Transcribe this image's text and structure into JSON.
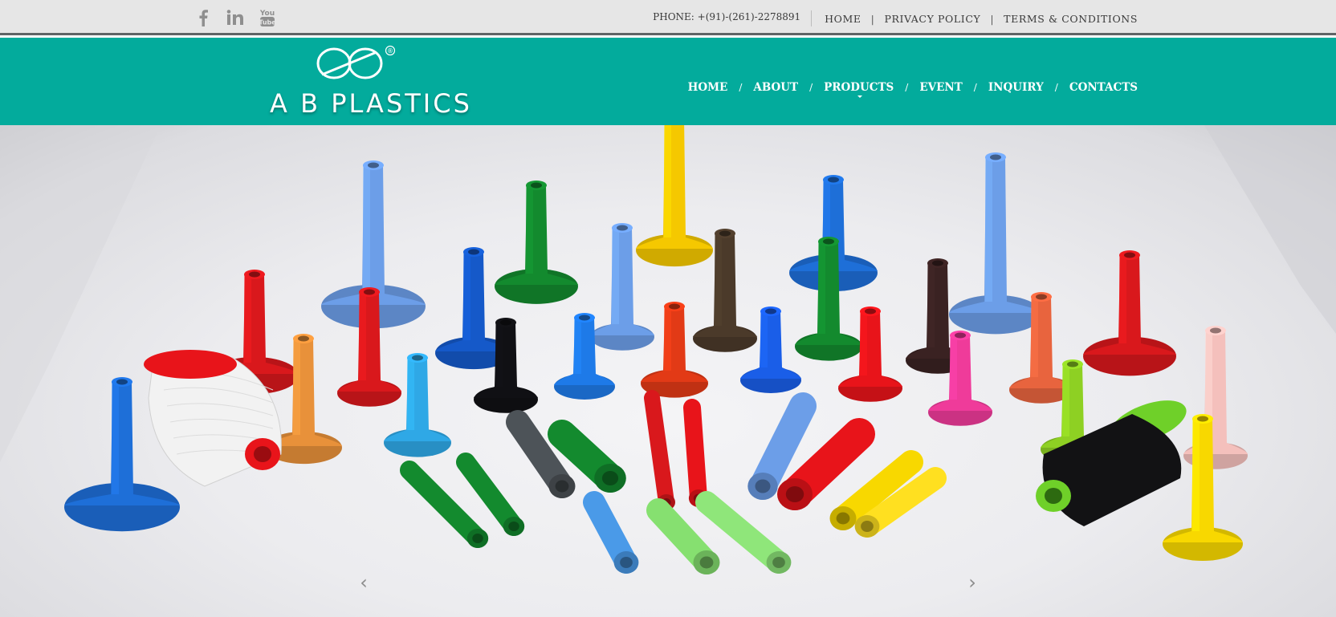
{
  "topbar": {
    "social": [
      {
        "name": "facebook-icon",
        "glyph": "f"
      },
      {
        "name": "linkedin-icon",
        "glyph": "in"
      },
      {
        "name": "youtube-icon",
        "glyph": "You Tube"
      }
    ],
    "phone": "PHONE: +(91)-(261)-2278891",
    "links": [
      {
        "label": "HOME"
      },
      {
        "label": "PRIVACY POLICY"
      },
      {
        "label": "TERMS & CONDITIONS"
      }
    ]
  },
  "header": {
    "brand": "A B PLASTICS",
    "registered": "®",
    "nav": [
      {
        "label": "HOME"
      },
      {
        "label": "ABOUT"
      },
      {
        "label": "PRODUCTS",
        "has_dropdown": true
      },
      {
        "label": "EVENT"
      },
      {
        "label": "INQUIRY"
      },
      {
        "label": "CONTACTS"
      }
    ],
    "accent_color": "#03ab9c"
  },
  "hero": {
    "image_subject": "colored plastic cones and spools",
    "prev_icon": "chevron-left-icon",
    "next_icon": "chevron-right-icon"
  }
}
